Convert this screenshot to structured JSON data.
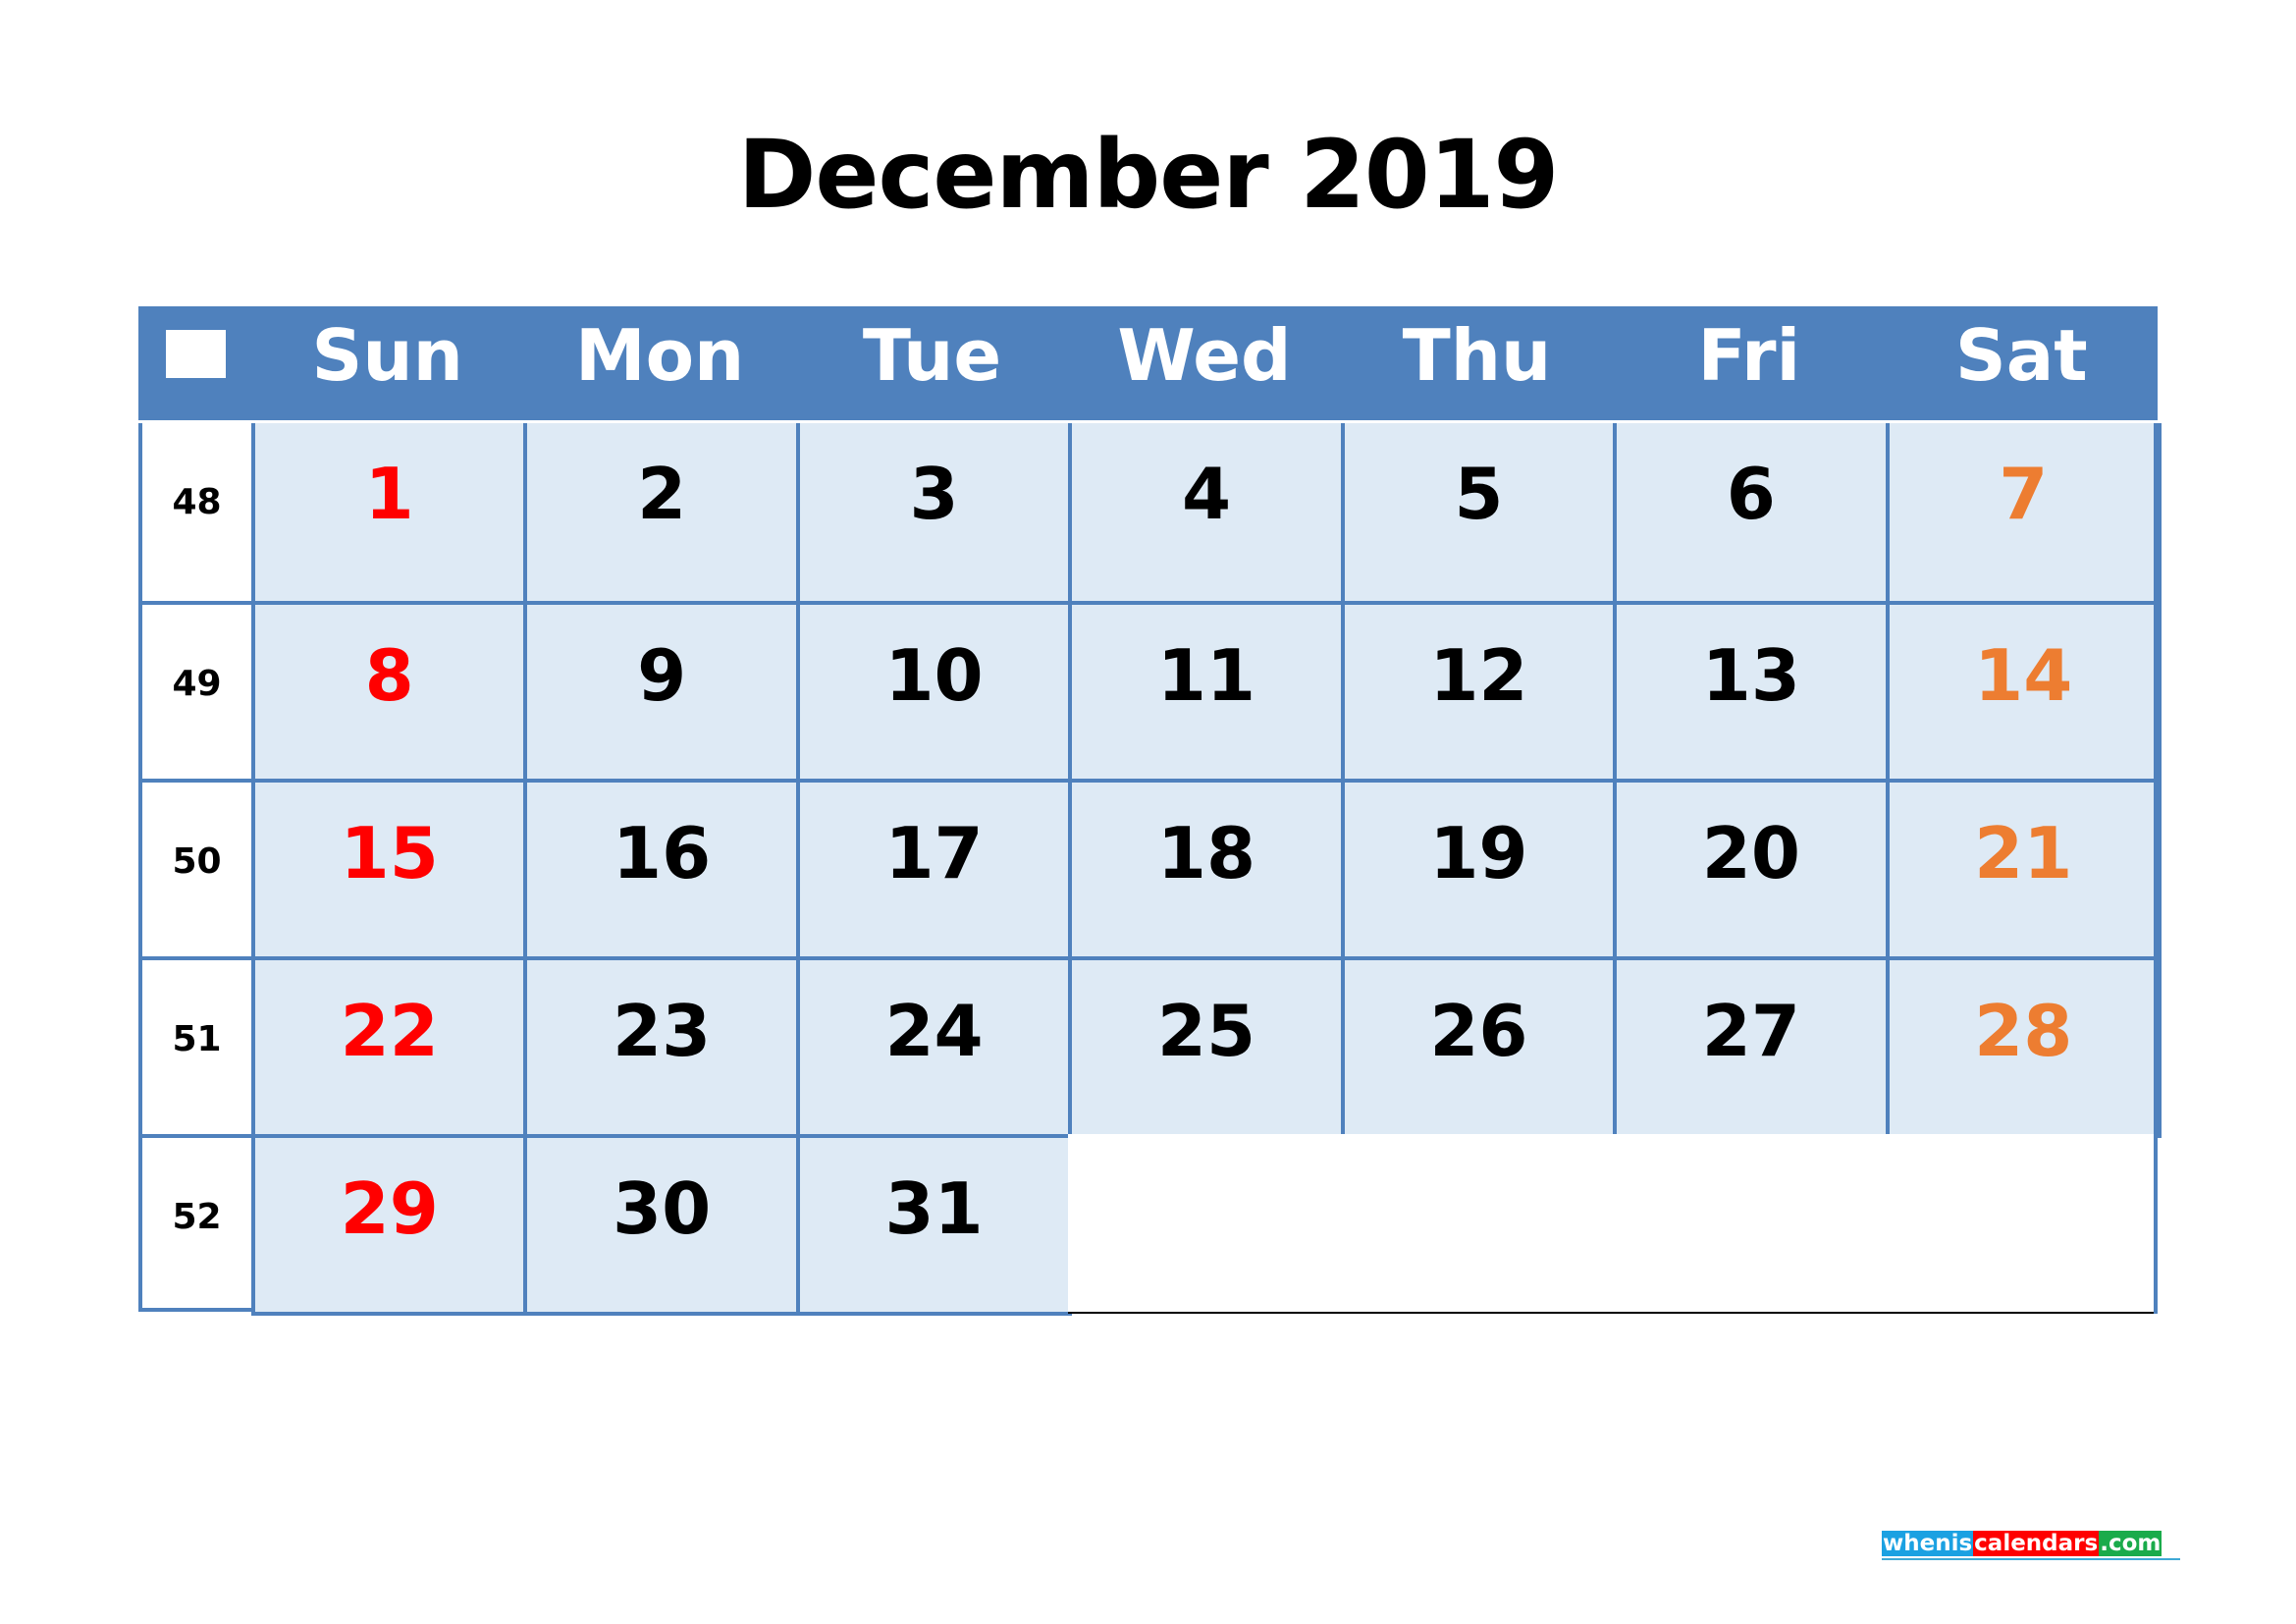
{
  "title": "December 2019",
  "colors": {
    "header_bg": "#4F81BD",
    "cell_bg": "#DEEAF5",
    "border": "#4F81BD",
    "sunday": "#FF0000",
    "saturday": "#ED7D31",
    "weekday": "#000000"
  },
  "header": {
    "week_icon": "square-icon",
    "days": [
      "Sun",
      "Mon",
      "Tue",
      "Wed",
      "Thu",
      "Fri",
      "Sat"
    ]
  },
  "weeks": [
    {
      "week": "48",
      "days": [
        "1",
        "2",
        "3",
        "4",
        "5",
        "6",
        "7"
      ]
    },
    {
      "week": "49",
      "days": [
        "8",
        "9",
        "10",
        "11",
        "12",
        "13",
        "14"
      ]
    },
    {
      "week": "50",
      "days": [
        "15",
        "16",
        "17",
        "18",
        "19",
        "20",
        "21"
      ]
    },
    {
      "week": "51",
      "days": [
        "22",
        "23",
        "24",
        "25",
        "26",
        "27",
        "28"
      ]
    },
    {
      "week": "52",
      "days": [
        "29",
        "30",
        "31",
        "",
        "",
        "",
        ""
      ]
    }
  ],
  "logo": {
    "parts": [
      {
        "text": "whenis",
        "bg": "#1BA1E2"
      },
      {
        "text": "calendars",
        "bg": "#FF0000"
      },
      {
        "text": ".com",
        "bg": "#1AAB4B"
      }
    ]
  }
}
